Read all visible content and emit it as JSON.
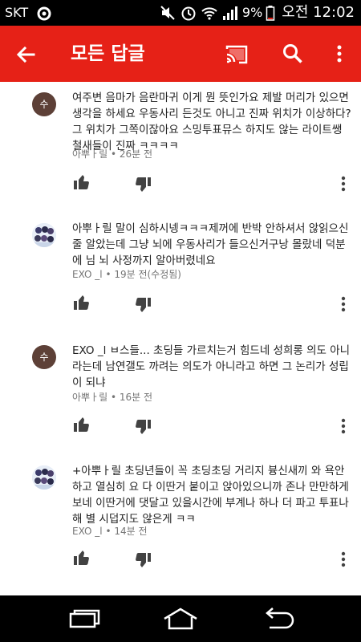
{
  "status_bar": {
    "carrier": "SKT",
    "battery": "9%",
    "time": "오전 12:02"
  },
  "app_bar": {
    "title": "모든 답글"
  },
  "comments": [
    {
      "avatar_letter": "수",
      "text": "여주변 음마가 음란마귀 이게 뭔 뜻인가요 제발 머리가 있으면 생각을 하세요 우동사리 든것도 아니고 진짜 위치가 이상하다? 그 위치가 그쪽이잖아요 스밍투표뮤스 하지도 않는 라이트쌩철새들이 진짜 ㅋㅋㅋㅋ",
      "meta": "아뿌ㅏ릴 • 26분 전"
    },
    {
      "avatar_letter": "",
      "text": "아뿌ㅏ릴 말이 심하시넹ㅋㅋㅋ제꺼에 반박 안하셔서 않읽으신줄 알았는데 그냥 뇌에 우동사리가 들으신거구낭 몰랐네 덕분에 님 뇌 사정까지 알아버렸네요",
      "meta": "EXO _l • 19분 전(수정됨)"
    },
    {
      "avatar_letter": "수",
      "text": "EXO _l ㅂ스들... 초딩들 가르치는거 힘드네 성희롱 의도 아니라는데 남연갤도 까려는 의도가 아니라고 하면 그 논리가 성립이 되냐",
      "meta": "아뿌ㅏ릴 • 16분 전"
    },
    {
      "avatar_letter": "",
      "text": "+아뿌ㅏ릴 초딩년들이 꼭 초딩초딩 거리지 븅신새끼 와 욕안하고 열심히 요 다 이딴거 붙이고 앉아있으니까 존나 만만하게 보네 이딴거에 댓달고 있을시간에 부계나 하나 더 파고 투표나해 별 시덥지도 않은게 ㅋㅋ",
      "meta": "EXO _l • 14분 전"
    }
  ]
}
